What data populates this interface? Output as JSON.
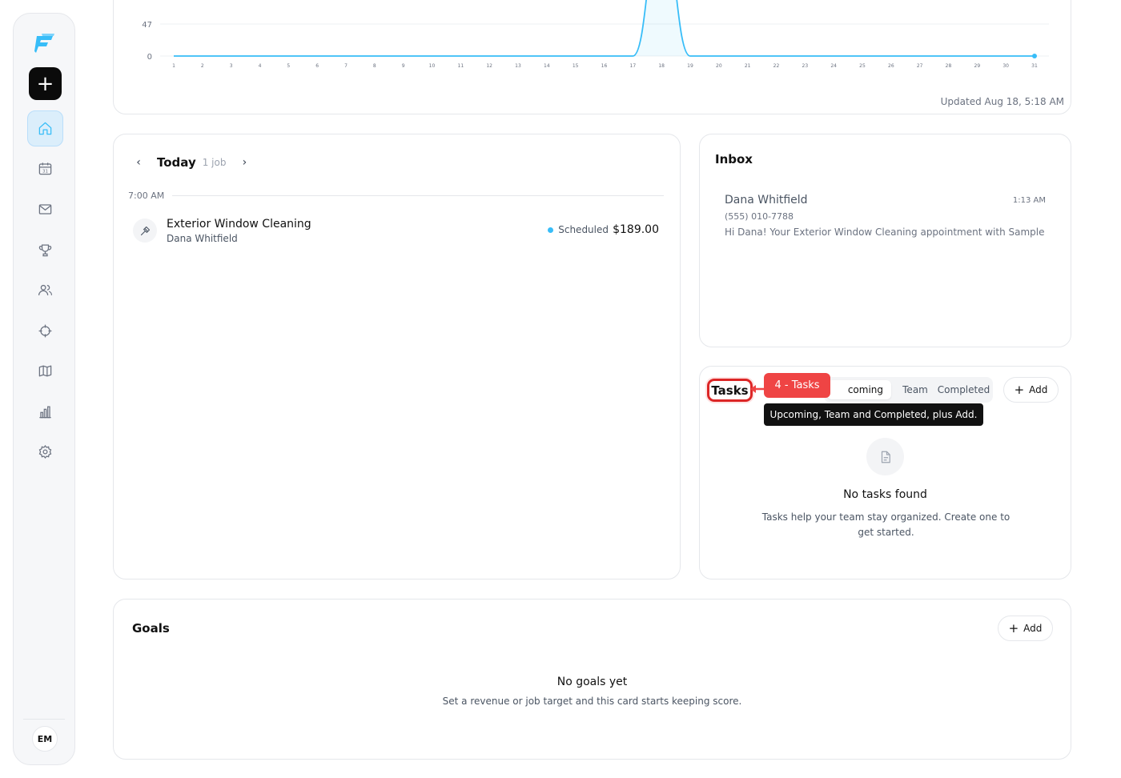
{
  "sidebar": {
    "add_label": "+",
    "nav": [
      {
        "name": "home",
        "icon": "home-icon",
        "active": true
      },
      {
        "name": "calendar",
        "icon": "calendar-icon",
        "badge": "31"
      },
      {
        "name": "inbox",
        "icon": "mail-icon"
      },
      {
        "name": "goals",
        "icon": "trophy-icon"
      },
      {
        "name": "customers",
        "icon": "users-icon"
      },
      {
        "name": "targets",
        "icon": "crosshair-icon"
      },
      {
        "name": "map",
        "icon": "map-icon"
      },
      {
        "name": "reports",
        "icon": "bar-chart-icon"
      },
      {
        "name": "settings",
        "icon": "gear-icon"
      }
    ],
    "avatar_initials": "EM"
  },
  "chart_card": {
    "updated_text": "Updated Aug 18, 5:18 AM"
  },
  "chart_data": {
    "type": "line",
    "x": [
      1,
      2,
      3,
      4,
      5,
      6,
      7,
      8,
      9,
      10,
      11,
      12,
      13,
      14,
      15,
      16,
      17,
      18,
      19,
      20,
      21,
      22,
      23,
      24,
      25,
      26,
      27,
      28,
      29,
      30,
      31
    ],
    "series": [
      {
        "values": [
          0,
          0,
          0,
          0,
          0,
          0,
          0,
          0,
          0,
          0,
          0,
          0,
          0,
          0,
          0,
          0,
          0,
          189,
          0,
          0,
          0,
          0,
          0,
          0,
          0,
          0,
          0,
          0,
          0,
          0,
          0
        ]
      }
    ],
    "y_ticks": [
      0,
      47
    ],
    "color": "#38bdf8",
    "grid": true
  },
  "schedule": {
    "prev_label": "‹",
    "next_label": "›",
    "day_label": "Today",
    "job_count": "1 job",
    "time_label": "7:00 AM",
    "job": {
      "title": "Exterior Window Cleaning",
      "client": "Dana Whitfield",
      "status": "Scheduled",
      "price": "$189.00",
      "icon": "hammer-icon"
    }
  },
  "inbox": {
    "title": "Inbox",
    "message": {
      "name": "Dana Whitfield",
      "time": "1:13 AM",
      "phone": "(555) 010-7788",
      "preview": "Hi Dana! Your Exterior Window Cleaning appointment with Sample Sh"
    }
  },
  "tasks": {
    "title": "Tasks",
    "tabs": [
      "Upcoming",
      "Team",
      "Completed"
    ],
    "selected_tab_visible_text": "coming",
    "add_label": "Add",
    "callout_label": "4 - Tasks",
    "tooltip": "Upcoming, Team and Completed, plus Add.",
    "empty_title": "No tasks found",
    "empty_desc": "Tasks help your team stay organized. Create one to get started."
  },
  "goals": {
    "title": "Goals",
    "add_label": "Add",
    "empty_title": "No goals yet",
    "empty_desc": "Set a revenue or job target and this card starts keeping score."
  }
}
